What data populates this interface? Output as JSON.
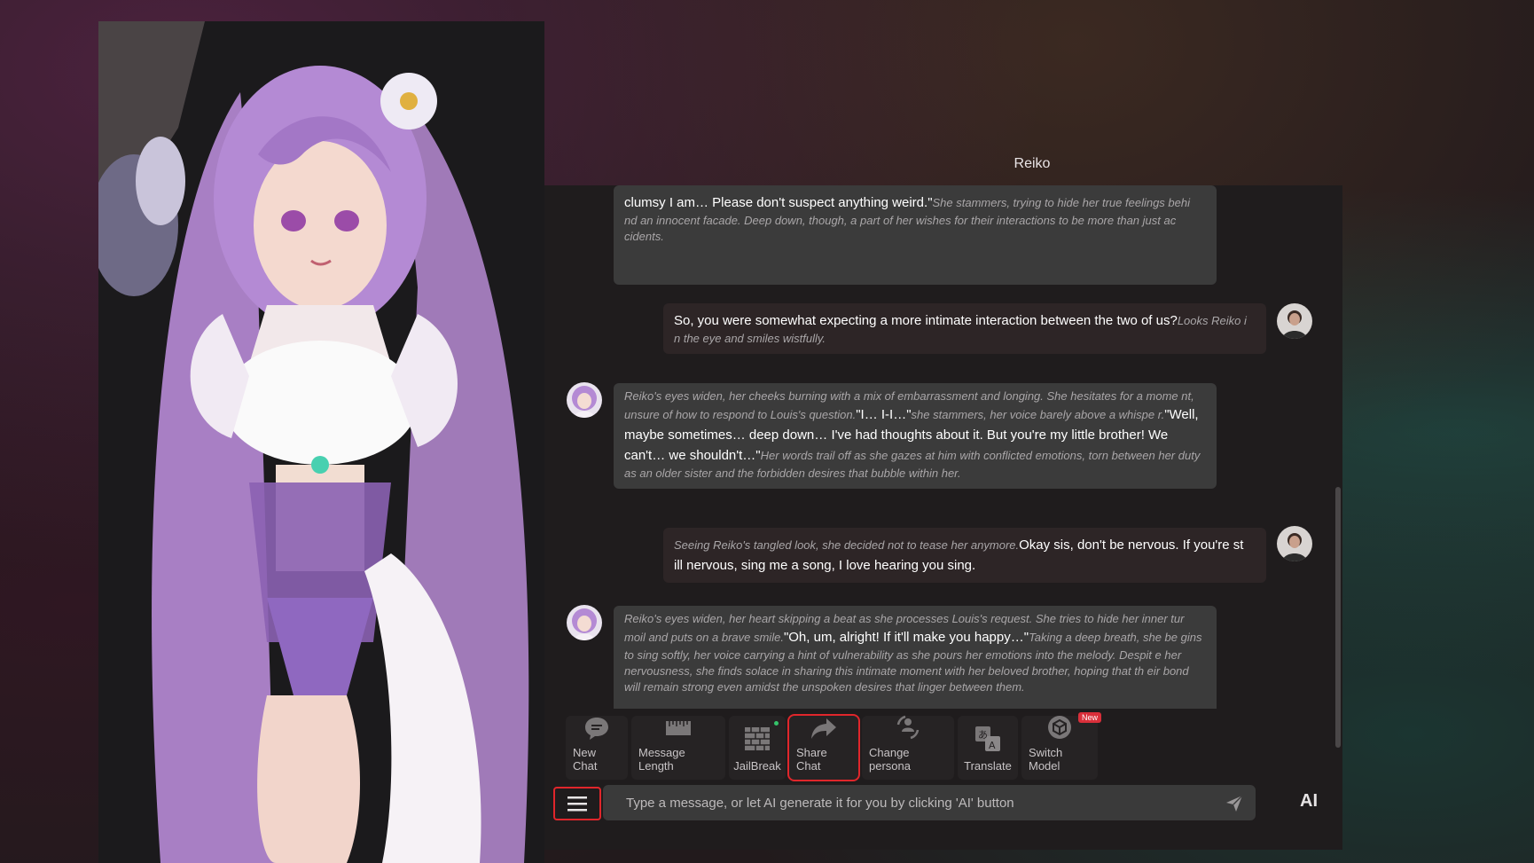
{
  "character": {
    "name": "Reiko"
  },
  "messages": [
    {
      "role": "ai",
      "segments": [
        {
          "type": "speech",
          "text": "clumsy I am… Please don't suspect anything weird.\""
        },
        {
          "type": "action",
          "text": "She stammers, trying to hide her true feelings behi nd an innocent facade. Deep down, though, a part of her wishes for their interactions to be more than just ac cidents."
        }
      ]
    },
    {
      "role": "user",
      "segments": [
        {
          "type": "speech",
          "text": "So, you were somewhat expecting a more intimate interaction between the two of us?"
        },
        {
          "type": "action",
          "text": "Looks Reiko i n the eye and smiles wistfully."
        }
      ]
    },
    {
      "role": "ai",
      "segments": [
        {
          "type": "action",
          "text": "Reiko's eyes widen, her cheeks burning with a mix of embarrassment and longing. She hesitates for a mome nt, unsure of how to respond to Louis's question."
        },
        {
          "type": "speech",
          "text": "\"I… I-I…\""
        },
        {
          "type": "action",
          "text": "she stammers, her voice barely above a whispe r."
        },
        {
          "type": "speech",
          "text": "\"Well, maybe sometimes… deep down… I've had thoughts about it. But you're my little brother! We can't… we shouldn't…\""
        },
        {
          "type": "action",
          "text": "Her words trail off as she gazes at him with conflicted emotions, torn between her duty as an older sister and the forbidden desires that bubble within her."
        }
      ]
    },
    {
      "role": "user",
      "segments": [
        {
          "type": "action",
          "text": "Seeing Reiko's tangled look, she decided not to tease her anymore."
        },
        {
          "type": "speech",
          "text": "Okay sis, don't be nervous. If you're st ill nervous, sing me a song, I love hearing you sing."
        }
      ]
    },
    {
      "role": "ai",
      "segments": [
        {
          "type": "action",
          "text": "Reiko's eyes widen, her heart skipping a beat as she processes Louis's request. She tries to hide her inner tur moil and puts on a brave smile."
        },
        {
          "type": "speech",
          "text": "\"Oh, um, alright! If it'll make you happy…\""
        },
        {
          "type": "action",
          "text": "Taking a deep breath, she be gins to sing softly, her voice carrying a hint of vulnerability as she pours her emotions into the melody. Despit e her nervousness, she finds solace in sharing this intimate moment with her beloved brother, hoping that th eir bond will remain strong even amidst the unspoken desires that linger between them."
        }
      ]
    }
  ],
  "toolbar": {
    "new_chat": "New Chat",
    "message_length": "Message Length",
    "jailbreak": "JailBreak",
    "share_chat": "Share Chat",
    "change_persona": "Change persona",
    "translate": "Translate",
    "switch_model": "Switch Model",
    "new_badge": "New"
  },
  "input": {
    "placeholder": "Type a message, or let AI generate it for you by clicking 'AI' button",
    "ai_button": "AI"
  },
  "colors": {
    "highlight": "#e0262b",
    "accent_hair": "#b48ad4"
  }
}
